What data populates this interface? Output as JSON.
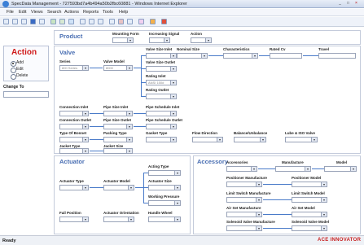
{
  "window": {
    "title": "SpecData Management - 727593bd7a4b494a50b2fbc60881 - Windows Internet Explorer",
    "controls": [
      "_",
      "□",
      "×"
    ]
  },
  "menu": [
    "File",
    "Edit",
    "Views",
    "Search",
    "Actions",
    "Reports",
    "Tools",
    "Help"
  ],
  "left": {
    "action_title": "Action",
    "options": [
      "Add",
      "Edit",
      "Delete"
    ],
    "selected_option": "Add",
    "change_to_label": "Change To"
  },
  "product": {
    "title": "Product",
    "mounting_form": "Mounting Form",
    "increasing_signal": "Increasing Signal",
    "action": "Action"
  },
  "valve": {
    "title": "Valve",
    "series": "Series",
    "series_value": "800 Series",
    "valve_model": "Valve Model",
    "valve_model_value": "8000",
    "valve_size_inlet": "Valve Size Inlet",
    "nominal_size": "Nominal Size",
    "characteristics": "Characteristics",
    "rated_cv": "Rated Cv",
    "travel": "Travel",
    "valve_size_outlet": "Valve Size Outlet",
    "rating_inlet": "Rating Inlet",
    "rating_inlet_value": "ANSI 150#",
    "rating_outlet": "Rating Outlet",
    "connection_inlet": "Connection Inlet",
    "pipe_size_inlet": "Pipe Size Inlet",
    "pipe_schedule_inlet": "Pipe Schedule Inlet",
    "connection_outlet": "Connection Outlet",
    "pipe_size_outlet": "Pipe Size Outlet",
    "pipe_schedule_outlet": "Pipe Schedule Outlet",
    "type_of_bonnet": "Type Of Bonnet",
    "packing_type": "Packing Type",
    "gasket_type": "Gasket Type",
    "flow_direction": "Flow Direction",
    "balance_unbalance": "Balance/Unbalance",
    "lube_iso_valve": "Lube & ISO Valve",
    "jacket_type": "Jacket Type",
    "jacket_size": "Jacket Size"
  },
  "actuator": {
    "title": "Actuator",
    "acting_type": "Acting Type",
    "actuator_type": "Actuator Type",
    "actuator_model": "Actuator Model",
    "actuator_size": "Actuator Size",
    "working_pressure": "Working Pressure",
    "fail_position": "Fail Position",
    "actuator_orientation": "Actuator Orientation",
    "handle_wheel": "Handle Wheel"
  },
  "accessory": {
    "title": "Accessory",
    "accessories": "Accessories",
    "manufacture": "Manufacture",
    "model": "Model",
    "positioner_manufacture": "Positioner Manufacture",
    "positioner_model": "Positioner Model",
    "limit_switch_manufacture": "Limit Switch Manufacture",
    "limit_switch_model": "Limit Switch Model",
    "air_set_manufacture": "Air Set Manufacture",
    "air_set_model": "Air Set Model",
    "solenoid_valve_manufacture": "Solenoid Valve Manufacture",
    "solenoid_valve_model": "Solenoid Valve Model"
  },
  "status": {
    "text": "Ready",
    "logo": "ACE INNOVATOR"
  },
  "colors": {
    "accent": "#4a6fb3",
    "action_red": "#d01919",
    "connector": "#4a7bc9"
  }
}
